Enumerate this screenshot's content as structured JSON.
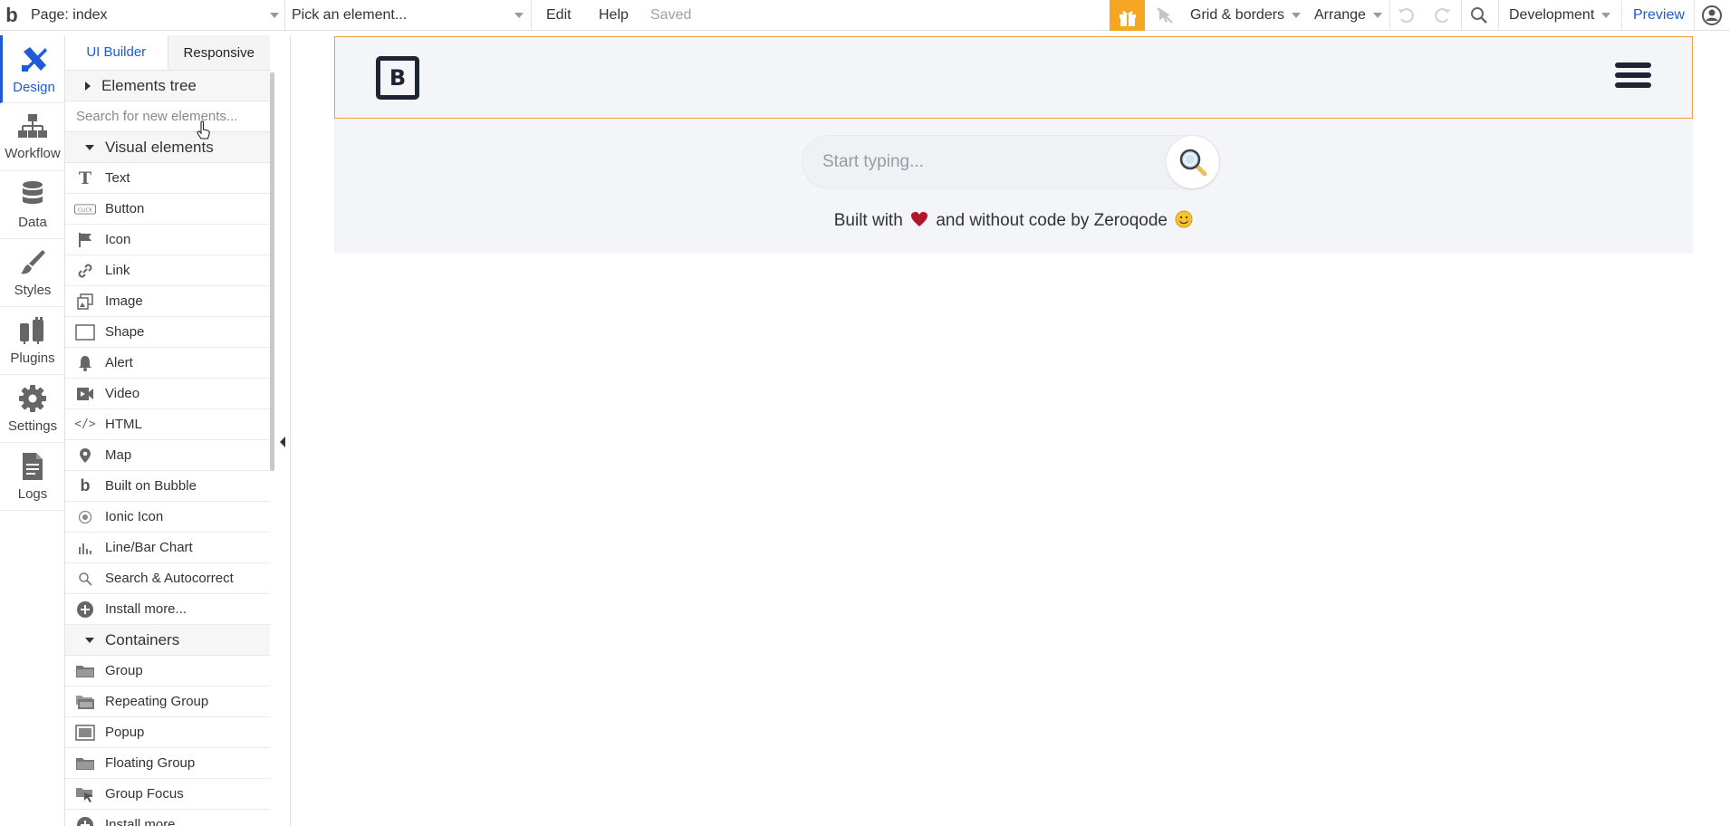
{
  "topbar": {
    "page_selector": "Page: index",
    "element_picker_placeholder": "Pick an element...",
    "menu_edit": "Edit",
    "menu_help": "Help",
    "save_status": "Saved",
    "grid_borders": "Grid & borders",
    "arrange": "Arrange",
    "environment": "Development",
    "preview": "Preview"
  },
  "leftnav": {
    "items": [
      {
        "label": "Design",
        "icon": "design-icon"
      },
      {
        "label": "Workflow",
        "icon": "workflow-icon"
      },
      {
        "label": "Data",
        "icon": "database-icon"
      },
      {
        "label": "Styles",
        "icon": "brush-icon"
      },
      {
        "label": "Plugins",
        "icon": "plugins-icon"
      },
      {
        "label": "Settings",
        "icon": "gear-icon"
      },
      {
        "label": "Logs",
        "icon": "document-icon"
      }
    ]
  },
  "panel": {
    "tab_ui_builder": "UI Builder",
    "tab_responsive": "Responsive",
    "elements_tree": "Elements tree",
    "search_placeholder": "Search for new elements...",
    "visual_elements_title": "Visual elements",
    "visual_elements": [
      {
        "label": "Text",
        "icon": "text-icon"
      },
      {
        "label": "Button",
        "icon": "button-icon"
      },
      {
        "label": "Icon",
        "icon": "flag-icon"
      },
      {
        "label": "Link",
        "icon": "link-icon"
      },
      {
        "label": "Image",
        "icon": "image-icon"
      },
      {
        "label": "Shape",
        "icon": "shape-icon"
      },
      {
        "label": "Alert",
        "icon": "bell-icon"
      },
      {
        "label": "Video",
        "icon": "video-icon"
      },
      {
        "label": "HTML",
        "icon": "code-icon"
      },
      {
        "label": "Map",
        "icon": "map-pin-icon"
      },
      {
        "label": "Built on Bubble",
        "icon": "bubble-icon"
      },
      {
        "label": "Ionic Icon",
        "icon": "ionic-icon"
      },
      {
        "label": "Line/Bar Chart",
        "icon": "chart-icon"
      },
      {
        "label": "Search & Autocorrect",
        "icon": "search-icon"
      },
      {
        "label": "Install more...",
        "icon": "plus-circle-icon"
      }
    ],
    "containers_title": "Containers",
    "containers": [
      {
        "label": "Group",
        "icon": "folder-icon"
      },
      {
        "label": "Repeating Group",
        "icon": "repeating-group-icon"
      },
      {
        "label": "Popup",
        "icon": "popup-icon"
      },
      {
        "label": "Floating Group",
        "icon": "floating-group-icon"
      },
      {
        "label": "Group Focus",
        "icon": "group-focus-icon"
      },
      {
        "label": "Install more...",
        "icon": "plus-circle-icon"
      }
    ]
  },
  "canvas": {
    "search_placeholder": "Start typing...",
    "credit_prefix": "Built with",
    "credit_middle": "and without code by Zeroqode",
    "logo_letter": "B"
  },
  "colors": {
    "accent": "#1e5bd4",
    "gift": "#f5a623",
    "header_border": "#f0a040",
    "page_bg": "#f4f5f9"
  }
}
